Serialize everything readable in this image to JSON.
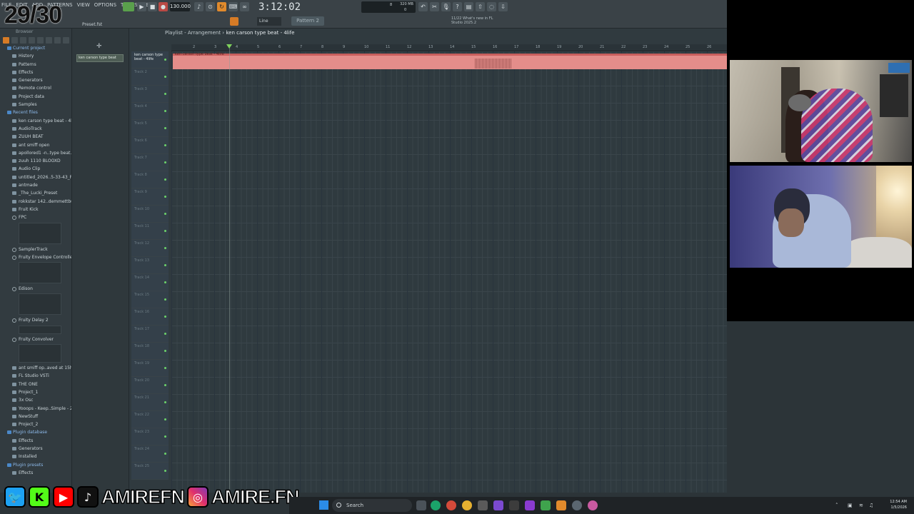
{
  "counter": "29/30",
  "menu": [
    "FILE",
    "EDIT",
    "ADD",
    "PATTERNS",
    "VIEW",
    "OPTIONS",
    "TOOLS",
    "HELP"
  ],
  "toolbar": {
    "tempo": "130.000",
    "time": "3:12:02",
    "snap": "Line",
    "pattern": "Pattern 2",
    "cpu_mem": "320 MB",
    "cpu_a": "8",
    "cpu_b": "0",
    "news_line1": "11/22  What's new in FL",
    "news_line2": "Studio 2025.2",
    "preset_label": "Preset.fst"
  },
  "browser": {
    "title": "Browser",
    "items": [
      {
        "label": "Current project",
        "kind": "head"
      },
      {
        "label": "History",
        "kind": "item"
      },
      {
        "label": "Patterns",
        "kind": "item"
      },
      {
        "label": "Effects",
        "kind": "item"
      },
      {
        "label": "Generators",
        "kind": "item"
      },
      {
        "label": "Remote control",
        "kind": "item"
      },
      {
        "label": "Project data",
        "kind": "item"
      },
      {
        "label": "Samples",
        "kind": "item"
      },
      {
        "label": "Recent files",
        "kind": "head"
      },
      {
        "label": "ken carson type beat - 4life",
        "kind": "item"
      },
      {
        "label": "AudioTrack",
        "kind": "item"
      },
      {
        "label": "ZUUH BEAT",
        "kind": "item"
      },
      {
        "label": "ant smiff open",
        "kind": "item"
      },
      {
        "label": "apollored1 -n..type beat.bop",
        "kind": "item"
      },
      {
        "label": "zuuh 1110 BLOOXD",
        "kind": "item"
      },
      {
        "label": "Audio Clip",
        "kind": "item"
      },
      {
        "label": "untitled_2026..5-33-43_REC",
        "kind": "item"
      },
      {
        "label": "antmade",
        "kind": "item"
      },
      {
        "label": "_The_Lucki_Preset",
        "kind": "item"
      },
      {
        "label": "rokkstar 142..demmettburth",
        "kind": "item"
      },
      {
        "label": "Fruit Kick",
        "kind": "item"
      }
    ],
    "plugins": [
      {
        "label": "FPC",
        "thumb_h": 30
      },
      {
        "label": "SamplerTrack",
        "thumb_h": 0
      },
      {
        "label": "Fruity Envelope Controller",
        "thumb_h": 30
      },
      {
        "label": "Edison",
        "thumb_h": 30
      },
      {
        "label": "Fruity Delay 2",
        "thumb_h": 12
      },
      {
        "label": "Fruity Convolver",
        "thumb_h": 26
      }
    ],
    "tail_items": [
      {
        "label": "ant smiff op..aved at 15h51",
        "kind": "item"
      },
      {
        "label": "FL Studio VSTi",
        "kind": "item"
      },
      {
        "label": "THE ONE",
        "kind": "item"
      },
      {
        "label": "Project_1",
        "kind": "item"
      },
      {
        "label": "3x Osc",
        "kind": "item"
      },
      {
        "label": "Yooops - Keep..Simple - 2015",
        "kind": "item"
      },
      {
        "label": "NewStuff",
        "kind": "item"
      },
      {
        "label": "Project_2",
        "kind": "item"
      },
      {
        "label": "Plugin database",
        "kind": "head"
      },
      {
        "label": "Effects",
        "kind": "item"
      },
      {
        "label": "Generators",
        "kind": "item"
      },
      {
        "label": "Installed",
        "kind": "item"
      },
      {
        "label": "Plugin presets",
        "kind": "head"
      },
      {
        "label": "Effects",
        "kind": "item"
      }
    ]
  },
  "pattern_list": {
    "item": "ken carson type beat"
  },
  "playlist": {
    "title_prefix": "Playlist - Arrangement",
    "title_name": "ken carson type beat - 4life",
    "clip_label": "ken carson type beat - 4life",
    "track1_name": "ken carson type beat - 4life",
    "tracks": [
      "Track 2",
      "Track 3",
      "Track 4",
      "Track 5",
      "Track 6",
      "Track 7",
      "Track 8",
      "Track 9",
      "Track 10",
      "Track 11",
      "Track 12",
      "Track 13",
      "Track 14",
      "Track 15",
      "Track 16",
      "Track 17",
      "Track 18",
      "Track 19",
      "Track 20",
      "Track 21",
      "Track 22",
      "Track 23",
      "Track 24",
      "Track 25"
    ],
    "ruler": [
      "2",
      "3",
      "4",
      "5",
      "6",
      "7",
      "8",
      "9",
      "10",
      "11",
      "12",
      "13",
      "14",
      "15",
      "16",
      "17",
      "18",
      "19",
      "20",
      "21",
      "22",
      "23",
      "24",
      "25",
      "26"
    ]
  },
  "social": {
    "handle1": "AMIREFN",
    "handle2": "AMIRE.FN"
  },
  "taskbar": {
    "search_placeholder": "Search",
    "time": "12:54 AM",
    "date": "1/5/2026"
  },
  "colors": {
    "clip": "#e48d8a",
    "accent": "#e08a2c",
    "playhead": "#7fd35c"
  }
}
